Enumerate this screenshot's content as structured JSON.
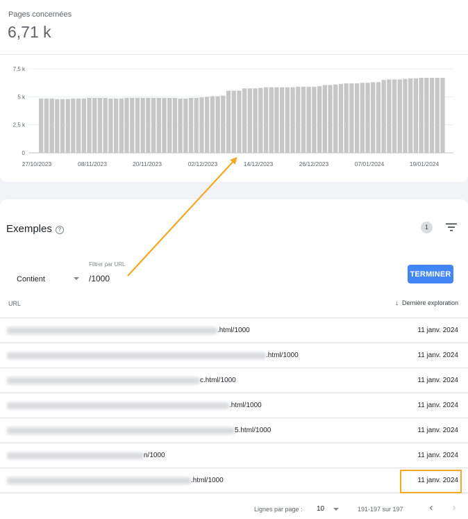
{
  "summary": {
    "label": "Pages concernées",
    "value": "6,71 k"
  },
  "chart_data": {
    "type": "bar",
    "yticks": [
      "0",
      "2,5 k",
      "5 k",
      "7,5 k"
    ],
    "ylim": [
      0,
      7500
    ],
    "xtick_labels": [
      "27/10/2023",
      "08/11/2023",
      "20/11/2023",
      "02/12/2023",
      "14/12/2023",
      "26/12/2023",
      "07/01/2024",
      "19/01/2024"
    ],
    "grid": true,
    "color": "#c6c6c6",
    "values": [
      4850,
      4850,
      4850,
      4800,
      4800,
      4800,
      4850,
      4850,
      4850,
      4900,
      4900,
      4900,
      4900,
      4850,
      4850,
      4850,
      4900,
      4900,
      4900,
      4900,
      4900,
      4900,
      4900,
      4900,
      4900,
      4900,
      4850,
      4850,
      4900,
      4900,
      4950,
      5000,
      5050,
      5050,
      5100,
      5550,
      5550,
      5550,
      5750,
      5750,
      5750,
      5800,
      5850,
      5850,
      5850,
      5850,
      5850,
      5850,
      5900,
      5900,
      5900,
      5900,
      5950,
      6050,
      6050,
      6100,
      6150,
      6200,
      6200,
      6200,
      6250,
      6250,
      6300,
      6300,
      6500,
      6550,
      6550,
      6550,
      6600,
      6650,
      6650,
      6700,
      6700,
      6700,
      6700,
      6700
    ]
  },
  "examples": {
    "title": "Exemples",
    "help_icon": "?",
    "filter_count": "1",
    "filter_icon": "filter-list-icon",
    "match_type": "Contient",
    "filter_label": "Filtrer par URL",
    "filter_value": "/1000",
    "done_button": "TERMINER",
    "col_url": "URL",
    "col_date": "Dernière exploration",
    "sort_icon": "↓",
    "rows": [
      {
        "url_suffix": ".html/1000",
        "date": "11 janv. 2024"
      },
      {
        "url_suffix": ".html/1000",
        "date": "11 janv. 2024"
      },
      {
        "url_suffix": "c.html/1000",
        "date": "11 janv. 2024"
      },
      {
        "url_suffix": ".html/1000",
        "date": "11 janv. 2024"
      },
      {
        "url_suffix": "5.html/1000",
        "date": "11 janv. 2024"
      },
      {
        "url_suffix": "n/1000",
        "date": "11 janv. 2024"
      },
      {
        "url_suffix": ".html/1000",
        "date": "11 janv. 2024"
      }
    ]
  },
  "pagination": {
    "rows_per_page_label": "Lignes par page :",
    "rows_per_page": "10",
    "range": "191-197 sur 197",
    "prev_icon": "‹",
    "next_icon": "›"
  },
  "annotation": {
    "color": "#f5a623"
  }
}
